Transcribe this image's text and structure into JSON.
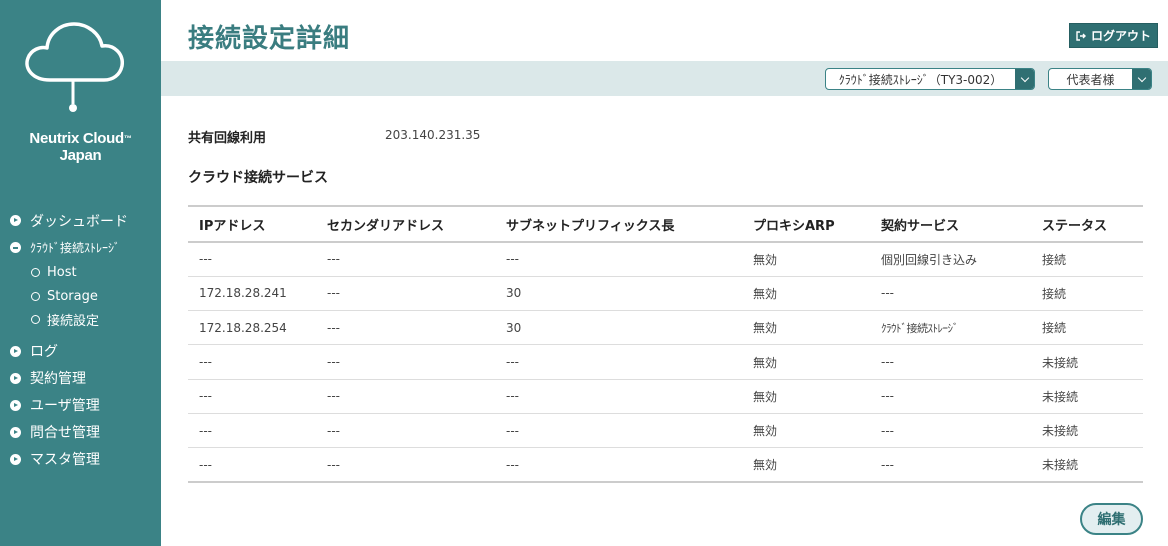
{
  "brand": {
    "line1": "Neutrix Cloud",
    "tm": "™",
    "line2": "Japan"
  },
  "nav": {
    "dashboard": "ダッシュボード",
    "storage_group": "ｸﾗｳﾄﾞ接続ｽﾄﾚｰｼﾞ",
    "sub": [
      "Host",
      "Storage",
      "接続設定"
    ],
    "log": "ログ",
    "contract": "契約管理",
    "user": "ユーザ管理",
    "inquiry": "問合せ管理",
    "master": "マスタ管理"
  },
  "header": {
    "title": "接続設定詳細",
    "logout_label": "ログアウト",
    "storage_select": "ｸﾗｳﾄﾞ接続ｽﾄﾚｰｼﾞ（TY3-002）",
    "user_select": "代表者様"
  },
  "info": {
    "label": "共有回線利用",
    "value": "203.140.231.35"
  },
  "section_title": "クラウド接続サービス",
  "table": {
    "headers": [
      "IPアドレス",
      "セカンダリアドレス",
      "サブネットプリフィックス長",
      "プロキシARP",
      "契約サービス",
      "ステータス"
    ],
    "rows": [
      [
        "---",
        "---",
        "---",
        "無効",
        "個別回線引き込み",
        "接続"
      ],
      [
        "172.18.28.241",
        "---",
        "30",
        "無効",
        "---",
        "接続"
      ],
      [
        "172.18.28.254",
        "---",
        "30",
        "無効",
        "ｸﾗｳﾄﾞ接続ｽﾄﾚｰｼﾞ",
        "接続"
      ],
      [
        "---",
        "---",
        "---",
        "無効",
        "---",
        "未接続"
      ],
      [
        "---",
        "---",
        "---",
        "無効",
        "---",
        "未接続"
      ],
      [
        "---",
        "---",
        "---",
        "無効",
        "---",
        "未接続"
      ],
      [
        "---",
        "---",
        "---",
        "無効",
        "---",
        "未接続"
      ]
    ]
  },
  "edit_label": "編集",
  "colors": {
    "sidebar": "#3b8386",
    "accent_dark": "#2f6f72",
    "subbar": "#dbe8e9",
    "title": "#3a7d80"
  }
}
